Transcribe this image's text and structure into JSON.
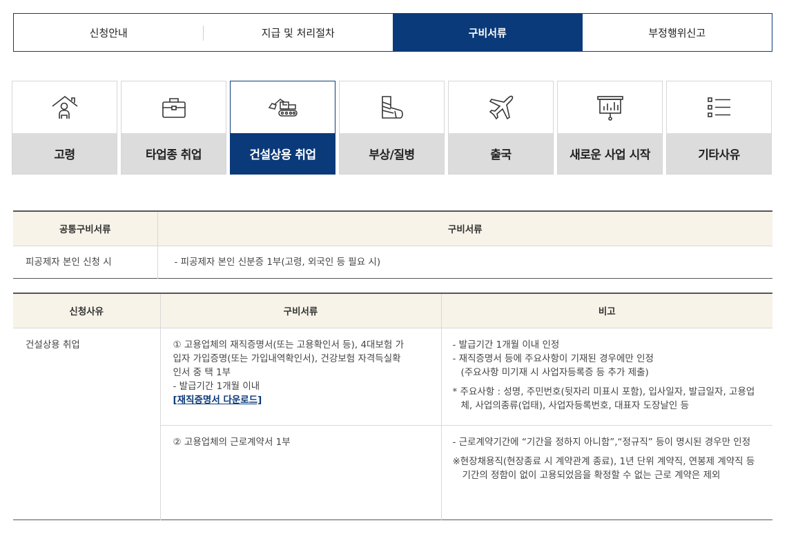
{
  "top_tabs": [
    {
      "label": "신청안내"
    },
    {
      "label": "지급 및 처리절차"
    },
    {
      "label": "구비서류",
      "active": true
    },
    {
      "label": "부정행위신고"
    }
  ],
  "categories": [
    {
      "label": "고령",
      "icon": "elderly-house-icon"
    },
    {
      "label": "타업종 취업",
      "icon": "briefcase-icon"
    },
    {
      "label": "건설상용 취업",
      "icon": "excavator-icon",
      "active": true
    },
    {
      "label": "부상/질병",
      "icon": "cast-injury-icon"
    },
    {
      "label": "출국",
      "icon": "airplane-icon"
    },
    {
      "label": "새로운 사업 시작",
      "icon": "presentation-board-icon"
    },
    {
      "label": "기타사유",
      "icon": "list-icon"
    }
  ],
  "common_table": {
    "headers": [
      "공통구비서류",
      "구비서류"
    ],
    "row": {
      "case": "피공제자 본인 신청 시",
      "doc": "- 피공제자 본인 신분증 1부(고령, 외국인 등 필요 시)"
    }
  },
  "detail_table": {
    "headers": [
      "신청사유",
      "구비서류",
      "비고"
    ],
    "reason": "건설상용 취업",
    "rows": [
      {
        "doc_lines": [
          "① 고용업체의 재직증명서(또는 고용확인서 등), 4대보험 가",
          "입자 가입증명(또는 가입내역확인서), 건강보험 자격득실확",
          "인서 중 택 1부",
          "- 발급기간 1개월 이내"
        ],
        "download_link": "[재직증명서 다운로드]",
        "notes": {
          "n1": "- 발급기간 1개월 이내 인정",
          "n2": "- 재직증명서 등에 주요사항이 기재된 경우에만 인정",
          "n3": "(주요사항 미기재 시 사업자등록증 등 추가 제출)",
          "n4": "* 주요사항 : 성명, 주민번호(뒷자리 미표시 포함), 입사일자, 발급일자, 고용업체, 사업의종류(업태), 사업자등록번호, 대표자 도장날인 등"
        }
      },
      {
        "doc": "② 고용업체의 근로계약서 1부",
        "notes": {
          "n1": "- 근로계약기간에 “기간을 정하지 아니함”,“정규직” 등이 명시된 경우만 인정",
          "n2": "※현장채용직(현장종료 시 계약관계 종료), 1년 단위 계약직, 연봉제 계약직 등 기간의 정함이 없이 고용되었음을 확정할 수 없는 근로 계약은 제외"
        }
      }
    ]
  }
}
